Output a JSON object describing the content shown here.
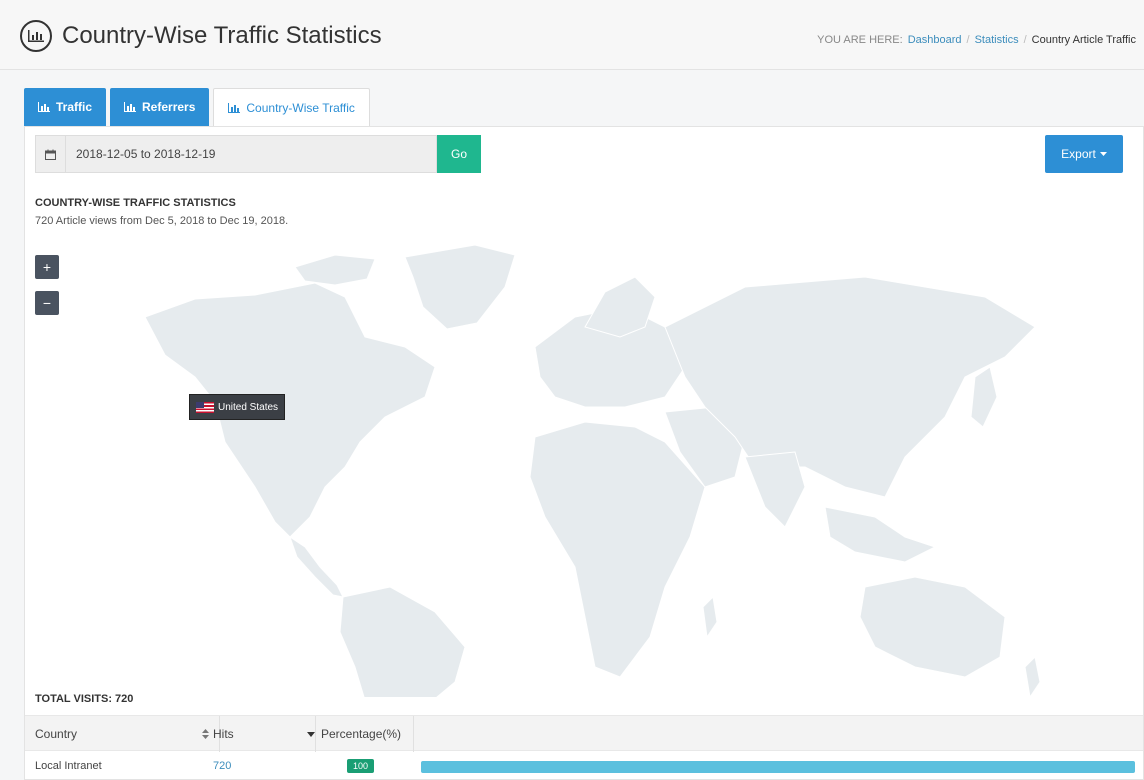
{
  "header": {
    "title": "Country-Wise Traffic Statistics",
    "breadcrumb": {
      "prefix": "YOU ARE HERE:",
      "items": [
        "Dashboard",
        "Statistics"
      ],
      "current": "Country Article Traffic"
    }
  },
  "tabs": [
    {
      "label": "Traffic",
      "icon": "bar-chart-icon"
    },
    {
      "label": "Referrers",
      "icon": "bar-chart-icon"
    },
    {
      "label": "Country-Wise Traffic",
      "icon": "bar-chart-icon",
      "active": true
    }
  ],
  "filter": {
    "date_range": "2018-12-05 to 2018-12-19",
    "go_label": "Go",
    "export_label": "Export"
  },
  "stats": {
    "heading": "COUNTRY-WISE TRAFFIC STATISTICS",
    "subheading": "720 Article views from Dec 5, 2018 to Dec 19, 2018."
  },
  "map": {
    "zoom_in": "+",
    "zoom_out": "−",
    "tooltip": "United States"
  },
  "total_visits": "TOTAL VISITS: 720",
  "table": {
    "headers": [
      "Country",
      "Hits",
      "Percentage(%)"
    ],
    "rows": [
      {
        "country": "Local Intranet",
        "hits": "720",
        "percentage": "100",
        "fill_fraction": 1.0
      }
    ]
  },
  "colors": {
    "primary": "#2d8fd5",
    "go": "#1fb78f",
    "badge": "#1a9e74",
    "bar": "#5bc0de",
    "land": "#e6ebee"
  }
}
